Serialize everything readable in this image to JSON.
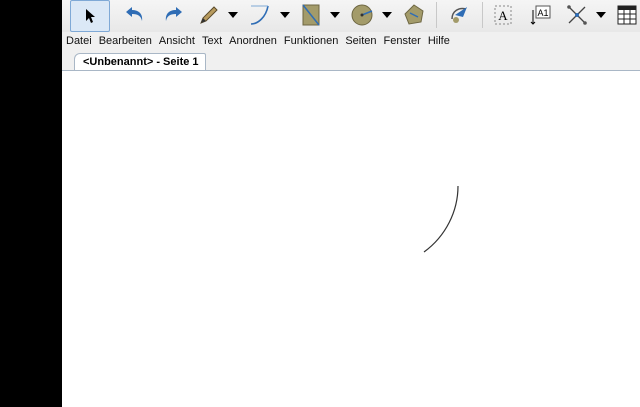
{
  "menubar": {
    "items": [
      "Datei",
      "Bearbeiten",
      "Ansicht",
      "Text",
      "Anordnen",
      "Funktionen",
      "Seiten",
      "Fenster",
      "Hilfe"
    ]
  },
  "tabs": [
    {
      "label": "<Unbenannt> - Seite 1",
      "active": true
    }
  ],
  "toolbar": {
    "tools": [
      {
        "icon": "arrow-pointer-icon",
        "selected": true
      },
      {
        "icon": "undo-icon"
      },
      {
        "icon": "redo-icon"
      },
      {
        "icon": "pencil-icon",
        "has_dropdown": true
      },
      {
        "icon": "curve-icon",
        "has_dropdown": true
      },
      {
        "icon": "rectangle-icon",
        "has_dropdown": true
      },
      {
        "icon": "circle-icon",
        "has_dropdown": true
      },
      {
        "icon": "polygon-icon"
      },
      {
        "icon": "transform-icon"
      },
      {
        "icon": "text-tool-icon"
      },
      {
        "icon": "text-frame-icon"
      },
      {
        "icon": "connector-icon",
        "has_dropdown": true
      },
      {
        "icon": "table-icon"
      }
    ]
  },
  "colors": {
    "toolbar_bg": "#ececec",
    "menubar_bg": "#f0f0f0",
    "selected_tool_bg": "#dbe8f6",
    "accent_blue": "#2f6db5",
    "shape_olive": "#a39b6a",
    "canvas_bg": "#ffffff"
  }
}
